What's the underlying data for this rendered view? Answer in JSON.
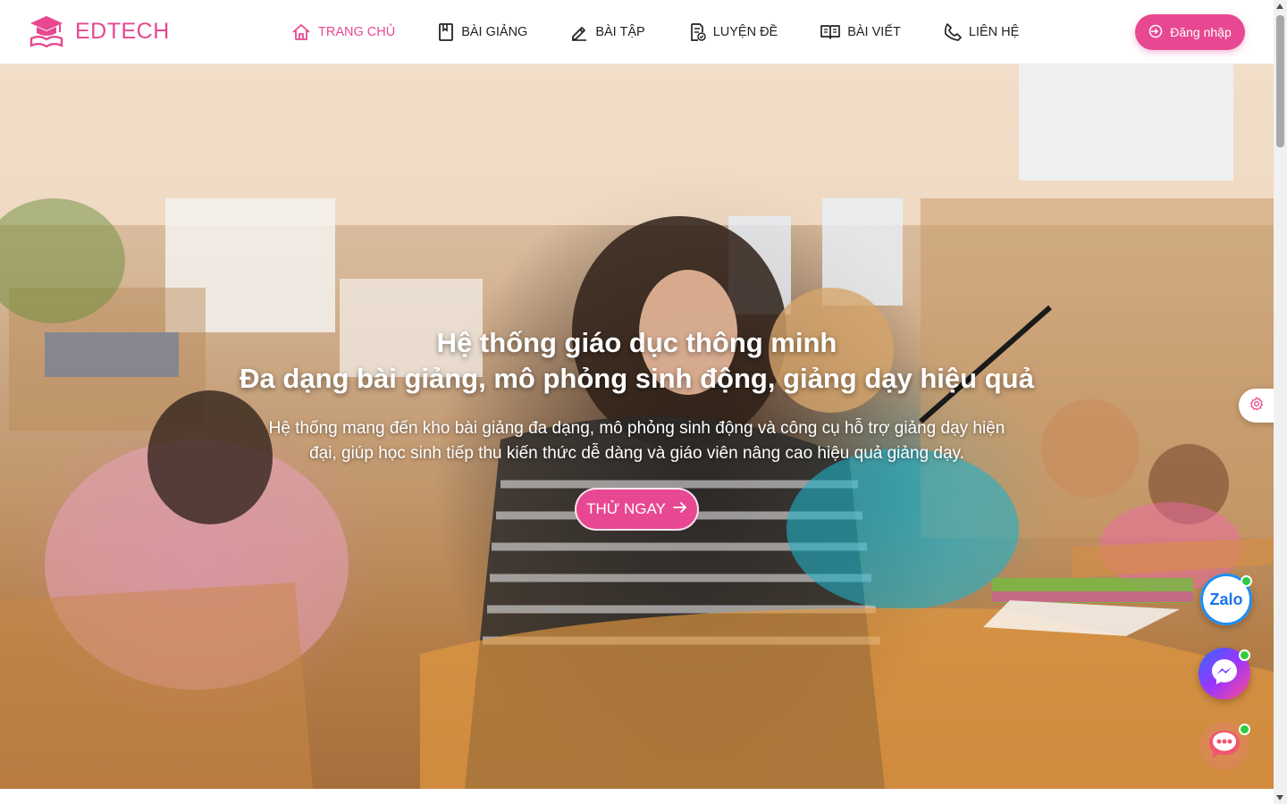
{
  "brand": {
    "name": "EDTECH",
    "icon": "graduation-cap-book-icon",
    "color": "#e74891"
  },
  "nav": {
    "items": [
      {
        "label": "TRANG CHỦ",
        "icon": "home-icon",
        "active": true
      },
      {
        "label": "BÀI GIẢNG",
        "icon": "bookmark-book-icon",
        "active": false
      },
      {
        "label": "BÀI TẬP",
        "icon": "pencil-icon",
        "active": false
      },
      {
        "label": "LUYỆN ĐỀ",
        "icon": "exam-sheet-icon",
        "active": false
      },
      {
        "label": "BÀI VIẾT",
        "icon": "open-book-icon",
        "active": false
      },
      {
        "label": "LIÊN HỆ",
        "icon": "phone-icon",
        "active": false
      }
    ]
  },
  "header": {
    "login_label": "Đăng nhập",
    "login_icon": "sign-in-icon"
  },
  "hero": {
    "title_line1": "Hệ thống giáo dục thông minh",
    "title_line2": "Đa dạng bài giảng, mô phỏng sinh động, giảng dạy hiệu quả",
    "description": "Hệ thống mang đến kho bài giảng đa dạng, mô phỏng sinh động và công cụ hỗ trợ giảng dạy hiện đại, giúp học sinh tiếp thu kiến thức dễ dàng và giáo viên nâng cao hiệu quả giảng dạy.",
    "cta_label": "THỬ NGAY",
    "cta_icon": "arrow-right-icon"
  },
  "floating": {
    "settings_icon": "gear-icon",
    "zalo_label": "Zalo",
    "messenger_icon": "messenger-icon",
    "chat_icon": "chat-bubble-icon"
  },
  "colors": {
    "accent": "#e74891",
    "text": "#222222",
    "online": "#2ecc40"
  }
}
